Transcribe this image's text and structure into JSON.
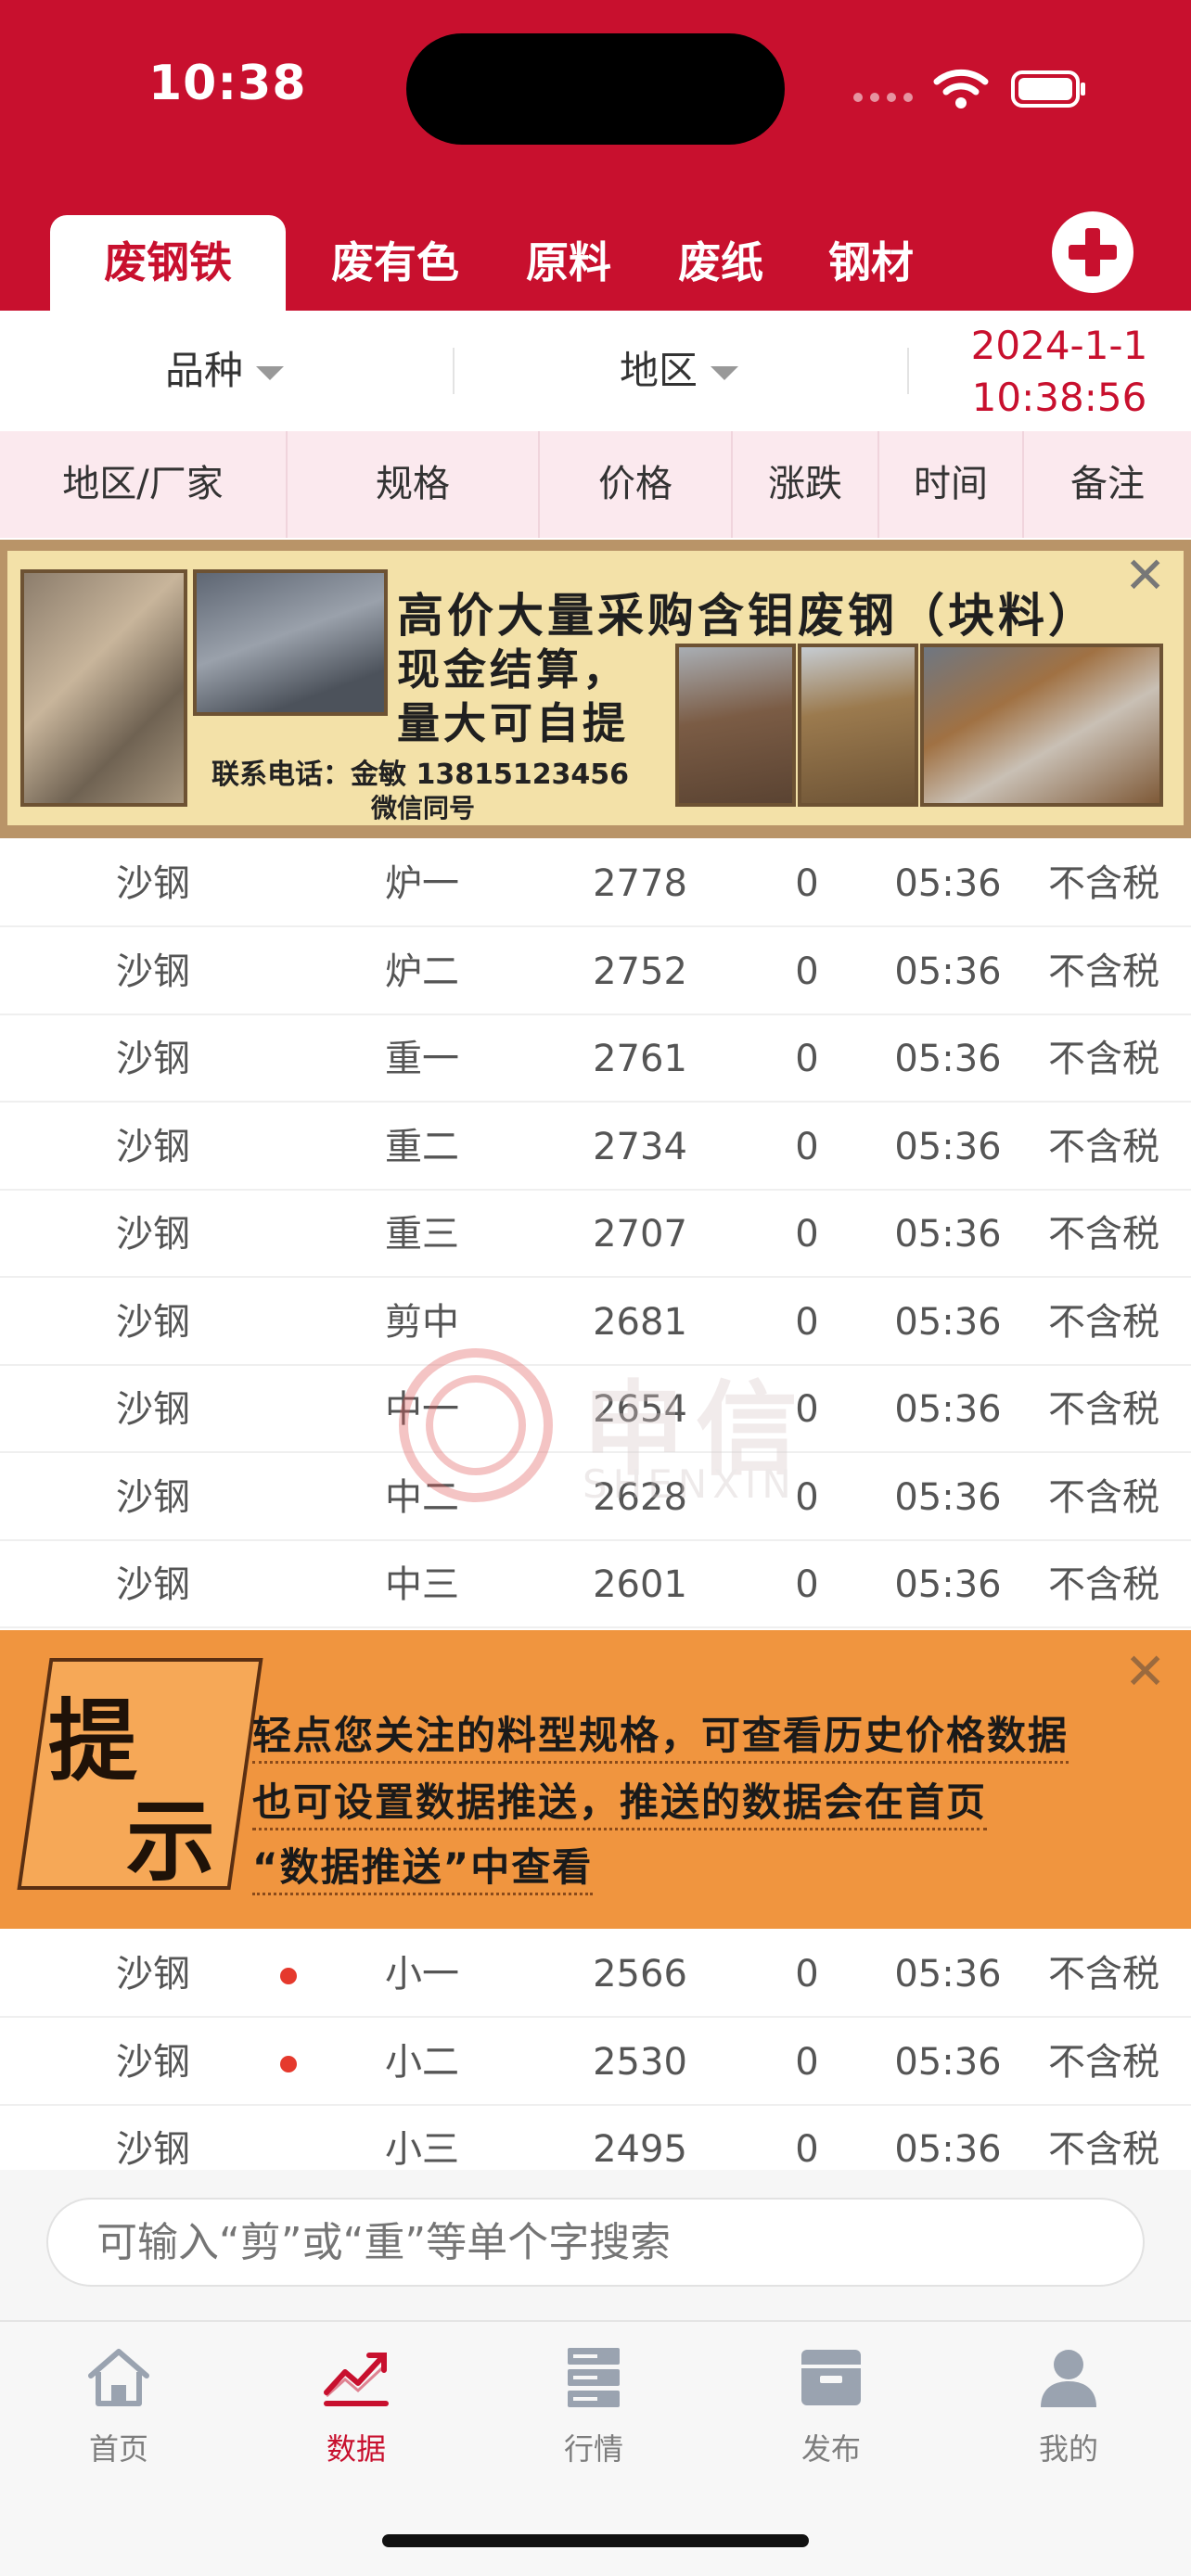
{
  "status": {
    "time": "10:38"
  },
  "tabs": [
    {
      "label": "废钢铁",
      "active": true
    },
    {
      "label": "废有色"
    },
    {
      "label": "原料"
    },
    {
      "label": "废纸"
    },
    {
      "label": "钢材"
    }
  ],
  "filters": {
    "variety": "品种",
    "region": "地区",
    "date": "2024-1-1",
    "time": "10:38:56"
  },
  "columns": [
    "地区/厂家",
    "规格",
    "价格",
    "涨跌",
    "时间",
    "备注"
  ],
  "ad": {
    "title": "高价大量采购含钼废钢（块料）",
    "line1": "现金结算，",
    "line2": "量大可自提",
    "contact": "联系电话：金敏  13815123456",
    "wechat": "微信同号"
  },
  "rows_a": [
    {
      "place": "沙钢",
      "spec": "炉一",
      "price": "2778",
      "change": "0",
      "time": "05:36",
      "note": "不含税"
    },
    {
      "place": "沙钢",
      "spec": "炉二",
      "price": "2752",
      "change": "0",
      "time": "05:36",
      "note": "不含税"
    },
    {
      "place": "沙钢",
      "spec": "重一",
      "price": "2761",
      "change": "0",
      "time": "05:36",
      "note": "不含税"
    },
    {
      "place": "沙钢",
      "spec": "重二",
      "price": "2734",
      "change": "0",
      "time": "05:36",
      "note": "不含税"
    },
    {
      "place": "沙钢",
      "spec": "重三",
      "price": "2707",
      "change": "0",
      "time": "05:36",
      "note": "不含税"
    },
    {
      "place": "沙钢",
      "spec": "剪中",
      "price": "2681",
      "change": "0",
      "time": "05:36",
      "note": "不含税"
    },
    {
      "place": "沙钢",
      "spec": "中一",
      "price": "2654",
      "change": "0",
      "time": "05:36",
      "note": "不含税"
    },
    {
      "place": "沙钢",
      "spec": "中二",
      "price": "2628",
      "change": "0",
      "time": "05:36",
      "note": "不含税"
    },
    {
      "place": "沙钢",
      "spec": "中三",
      "price": "2601",
      "change": "0",
      "time": "05:36",
      "note": "不含税"
    }
  ],
  "tip": {
    "big1": "提",
    "big2": "示",
    "line1": "轻点您关注的料型规格，可查看历史价格数据",
    "line2": "也可设置数据推送，推送的数据会在首页",
    "line3": "“数据推送”中查看"
  },
  "rows_b": [
    {
      "place": "沙钢",
      "spec": "小一",
      "price": "2566",
      "change": "0",
      "time": "05:36",
      "note": "不含税"
    },
    {
      "place": "沙钢",
      "spec": "小二",
      "price": "2530",
      "change": "0",
      "time": "05:36",
      "note": "不含税"
    },
    {
      "place": "沙钢",
      "spec": "小三",
      "price": "2495",
      "change": "0",
      "time": "05:36",
      "note": "不含税"
    }
  ],
  "watermark": {
    "cn": "申信",
    "en": "SHENXIN"
  },
  "search": {
    "placeholder": "可输入“剪”或“重”等单个字搜索"
  },
  "nav": [
    {
      "label": "首页",
      "icon": "home-icon"
    },
    {
      "label": "数据",
      "icon": "chart-icon",
      "active": true
    },
    {
      "label": "行情",
      "icon": "server-icon"
    },
    {
      "label": "发布",
      "icon": "box-icon"
    },
    {
      "label": "我的",
      "icon": "user-icon"
    }
  ],
  "colors": {
    "brand": "#c8102e",
    "tip_orange": "#f0953f",
    "ad_cream": "#f3e1a8"
  }
}
